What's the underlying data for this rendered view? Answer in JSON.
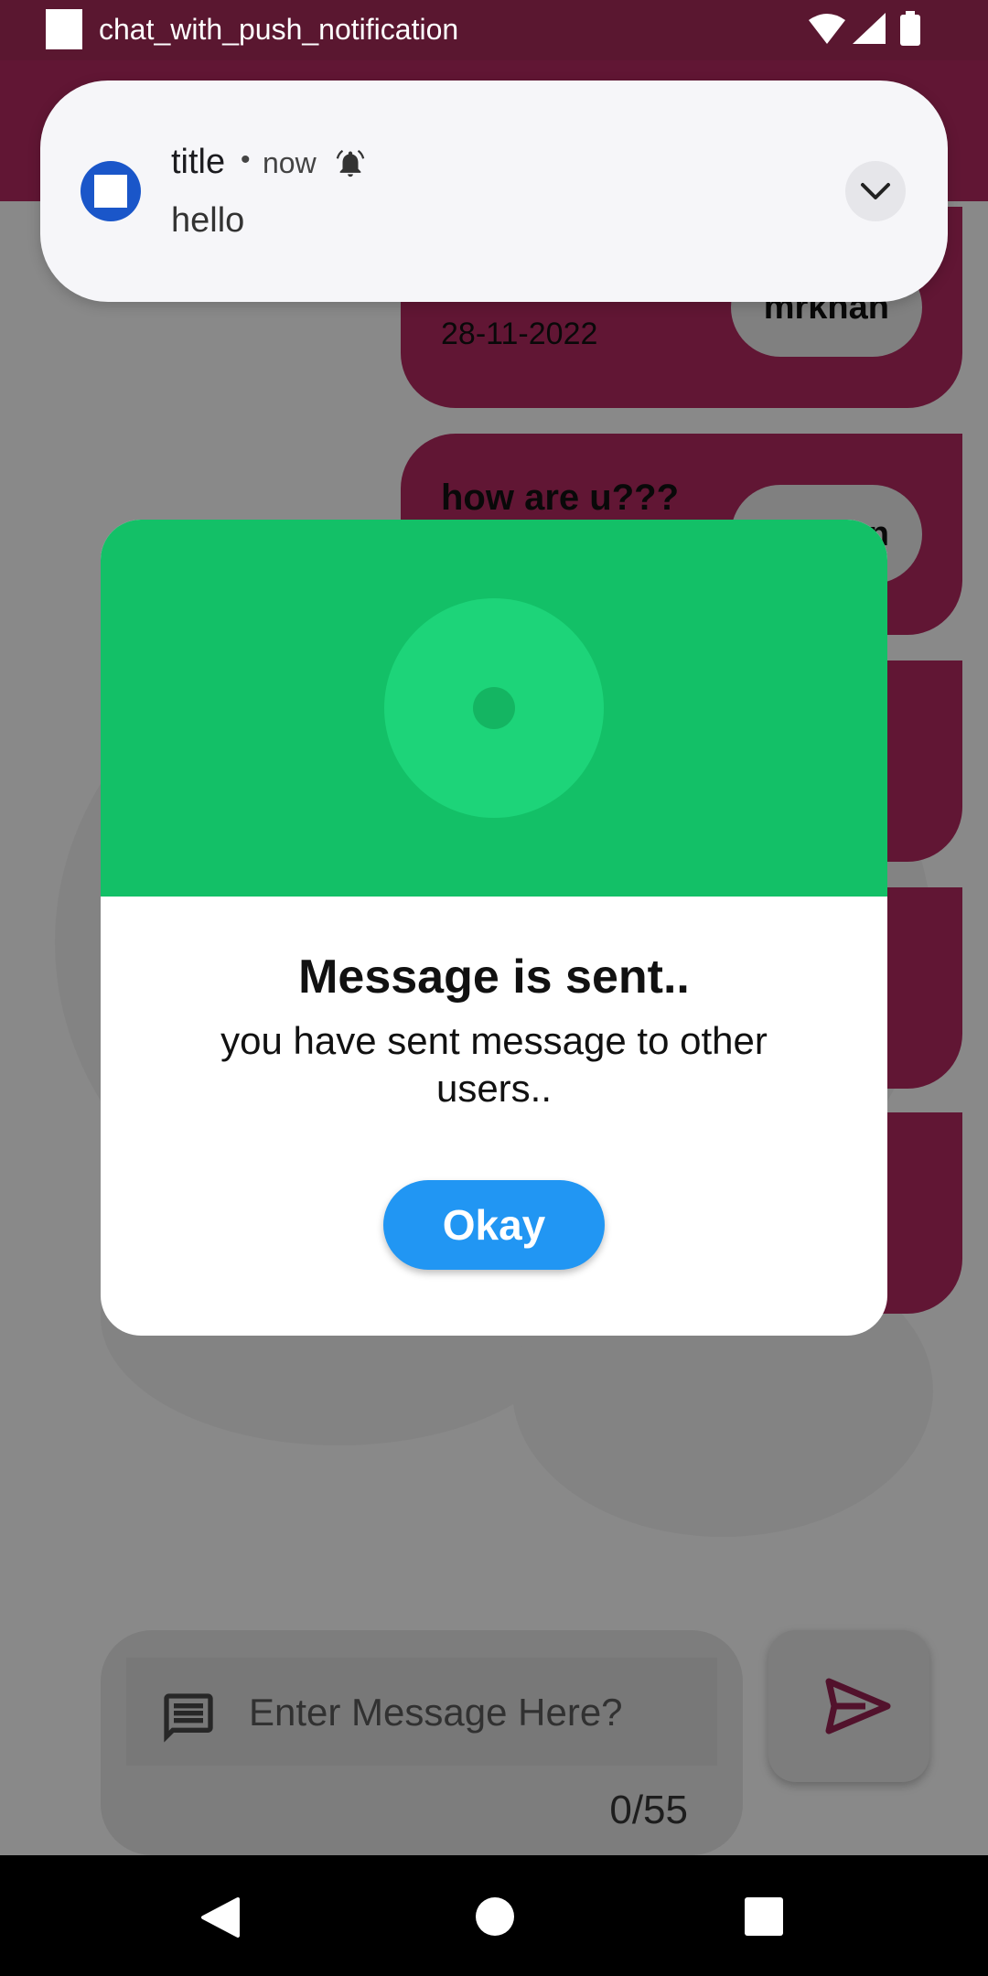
{
  "status_bar": {
    "app_name": "chat_with_push_notification",
    "icons": [
      "wifi-icon",
      "cell-signal-icon",
      "battery-icon"
    ]
  },
  "notification": {
    "title": "title",
    "separator": "•",
    "time": "now",
    "body": "hello",
    "icons": [
      "app-icon",
      "bell-icon",
      "chevron-down-icon"
    ]
  },
  "messages": [
    {
      "text": "",
      "date": "28-11-2022",
      "user": "mrkhan"
    },
    {
      "text": "how are u???",
      "date": "",
      "user": "mrkhan"
    },
    {
      "text": "",
      "date": "",
      "user": ""
    },
    {
      "text": "",
      "date": "",
      "user": ""
    },
    {
      "text": "",
      "date": "",
      "user": ""
    }
  ],
  "composer": {
    "placeholder": "Enter Message Here?",
    "counter": "0/55"
  },
  "dialog": {
    "title": "Message is sent..",
    "text": "you have sent message to other users..",
    "ok_label": "Okay"
  },
  "colors": {
    "app_primary": "#a8265a",
    "dialog_header": "#13c067",
    "ok_button": "#2196f3"
  }
}
